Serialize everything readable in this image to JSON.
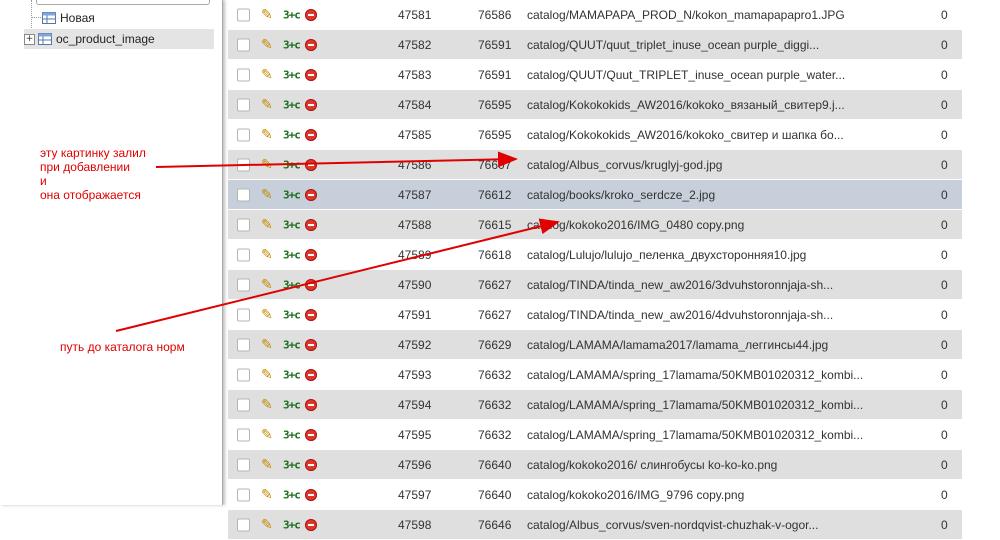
{
  "sidebar": {
    "items": [
      {
        "label": "Новая"
      },
      {
        "label": "oc_product_image",
        "expander": "+"
      }
    ]
  },
  "table": {
    "rows": [
      {
        "id": "47581",
        "pid": "76586",
        "image": "catalog/MAMAPAPA_PROD_N/kokon_mamapapapro1.JPG",
        "order": "0"
      },
      {
        "id": "47582",
        "pid": "76591",
        "image": "catalog/QUUT/quut_triplet_inuse_ocean purple_diggi...",
        "order": "0"
      },
      {
        "id": "47583",
        "pid": "76591",
        "image": "catalog/QUUT/Quut_TRIPLET_inuse_ocean purple_water...",
        "order": "0"
      },
      {
        "id": "47584",
        "pid": "76595",
        "image": "catalog/Kokokokids_AW2016/kokoko_вязаный_свитер9.j...",
        "order": "0"
      },
      {
        "id": "47585",
        "pid": "76595",
        "image": "catalog/Kokokokids_AW2016/kokoko_свитер и шапка бо...",
        "order": "0"
      },
      {
        "id": "47586",
        "pid": "76607",
        "image": "catalog/Albus_corvus/kruglyj-god.jpg",
        "order": "0"
      },
      {
        "id": "47587",
        "pid": "76612",
        "image": "catalog/books/kroko_serdcze_2.jpg",
        "order": "0"
      },
      {
        "id": "47588",
        "pid": "76615",
        "image": "catalog/kokoko2016/IMG_0480 copy.png",
        "order": "0"
      },
      {
        "id": "47589",
        "pid": "76618",
        "image": "catalog/Lulujo/lulujo_пеленка_двухсторонняя10.jpg",
        "order": "0"
      },
      {
        "id": "47590",
        "pid": "76627",
        "image": "catalog/TINDA/tinda_new_aw2016/3dvuhstoronnjaja-sh...",
        "order": "0"
      },
      {
        "id": "47591",
        "pid": "76627",
        "image": "catalog/TINDA/tinda_new_aw2016/4dvuhstoronnjaja-sh...",
        "order": "0"
      },
      {
        "id": "47592",
        "pid": "76629",
        "image": "catalog/LAMAMA/lamama2017/lamama_леггинсы44.jpg",
        "order": "0"
      },
      {
        "id": "47593",
        "pid": "76632",
        "image": "catalog/LAMAMA/spring_17lamama/50KMB01020312_kombi...",
        "order": "0"
      },
      {
        "id": "47594",
        "pid": "76632",
        "image": "catalog/LAMAMA/spring_17lamama/50KMB01020312_kombi...",
        "order": "0"
      },
      {
        "id": "47595",
        "pid": "76632",
        "image": "catalog/LAMAMA/spring_17lamama/50KMB01020312_kombi...",
        "order": "0"
      },
      {
        "id": "47596",
        "pid": "76640",
        "image": "catalog/kokoko2016/ слингобусы ko-ko-ko.png",
        "order": "0"
      },
      {
        "id": "47597",
        "pid": "76640",
        "image": "catalog/kokoko2016/IMG_9796 copy.png",
        "order": "0"
      },
      {
        "id": "47598",
        "pid": "76646",
        "image": "catalog/Albus_corvus/sven-nordqvist-chuzhak-v-ogor...",
        "order": "0"
      }
    ],
    "action_icons": {
      "edit": "pencil-icon",
      "copy": "copy-icon",
      "delete": "delete-icon"
    }
  },
  "annotations": {
    "note1": [
      "эту картинку залил",
      "при добавлении",
      "и",
      "она отображается"
    ],
    "note2": "путь до каталога норм",
    "color": "#e00000"
  },
  "colors": {
    "row_odd": "#ffffff",
    "row_even": "#dfdfdf",
    "row_highlight": "#c7cfdb",
    "delete_icon": "#e0352b"
  }
}
